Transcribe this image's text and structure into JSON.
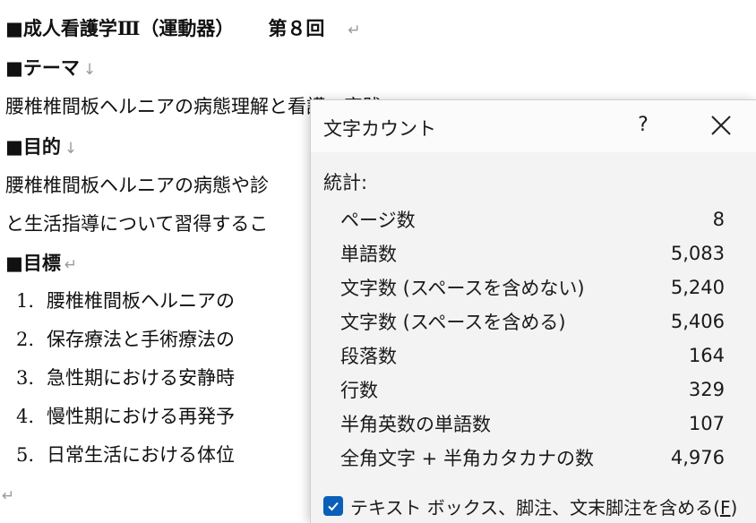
{
  "document": {
    "title_line": "■成人看護学Ⅲ（運動器）",
    "title_session": "第８回",
    "theme_heading": "■テーマ",
    "theme_text": "腰椎椎間板ヘルニアの病態理解と看護の実践",
    "purpose_heading": "■目的",
    "purpose_text_1": "腰椎椎間板ヘルニアの病態や診",
    "purpose_text_2": "と生活指導について習得するこ",
    "goals_heading": "■目標",
    "goals": [
      {
        "num": "1.",
        "text": "腰椎椎間板ヘルニアの"
      },
      {
        "num": "2.",
        "text": "保存療法と手術療法の"
      },
      {
        "num": "3.",
        "text": "急性期における安静時"
      },
      {
        "num": "4.",
        "text": "慢性期における再発予"
      },
      {
        "num": "5.",
        "text": "日常生活における体位"
      }
    ],
    "para_mark": "↵",
    "line_break_mark": "↓"
  },
  "dialog": {
    "title": "文字カウント",
    "help_label": "?",
    "section_label": "統計:",
    "stats": [
      {
        "label": "ページ数",
        "value": "8"
      },
      {
        "label": "単語数",
        "value": "5,083"
      },
      {
        "label": "文字数 (スペースを含めない)",
        "value": "5,240"
      },
      {
        "label": "文字数 (スペースを含める)",
        "value": "5,406"
      },
      {
        "label": "段落数",
        "value": "164"
      },
      {
        "label": "行数",
        "value": "329"
      },
      {
        "label": "半角英数の単語数",
        "value": "107"
      },
      {
        "label": "全角文字 + 半角カタカナの数",
        "value": "4,976"
      }
    ],
    "checkbox_label": "テキスト ボックス、脚注、文末脚注を含める(",
    "checkbox_key": "F",
    "checkbox_close": ")",
    "checkbox_checked": true,
    "accent_color": "#0a5fb8"
  }
}
